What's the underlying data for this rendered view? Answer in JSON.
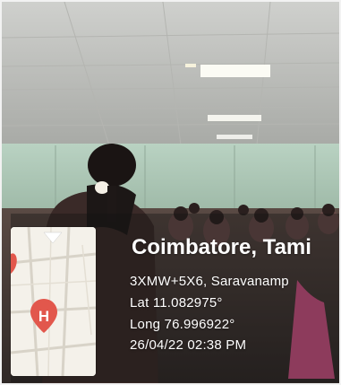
{
  "location": {
    "city": "Coimbatore, Tami",
    "address": "3XMW+5X6, Saravanamp",
    "latitude": "Lat 11.082975°",
    "longitude": "Long 76.996922°",
    "datetime": "26/04/22 02:38 PM"
  },
  "map": {
    "pin_letter": "H",
    "pin_color": "#e2574c"
  }
}
